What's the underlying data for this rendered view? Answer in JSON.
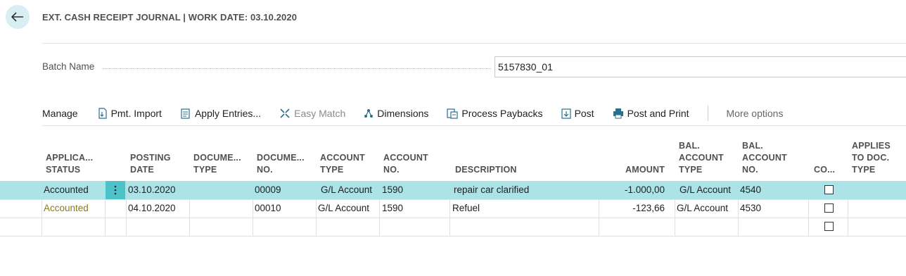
{
  "header": {
    "title": "EXT. CASH RECEIPT JOURNAL | WORK DATE: 03.10.2020"
  },
  "batch": {
    "label": "Batch Name",
    "value": "5157830_01"
  },
  "actions": {
    "manage": "Manage",
    "pmt_import": "Pmt. Import",
    "apply_entries": "Apply Entries...",
    "easy_match": "Easy Match",
    "dimensions": "Dimensions",
    "process_paybacks": "Process Paybacks",
    "post": "Post",
    "post_and_print": "Post and Print",
    "more_options": "More options"
  },
  "columns": {
    "applica_status": [
      "APPLICA...",
      "STATUS"
    ],
    "posting_date": [
      "POSTING",
      "DATE"
    ],
    "document_type": [
      "DOCUME...",
      "TYPE"
    ],
    "document_no": [
      "DOCUME...",
      "NO."
    ],
    "account_type": [
      "ACCOUNT",
      "TYPE"
    ],
    "account_no": [
      "ACCOUNT",
      "NO."
    ],
    "description": [
      "DESCRIPTION"
    ],
    "amount": [
      "AMOUNT"
    ],
    "bal_account_type": [
      "BAL.",
      "ACCOUNT",
      "TYPE"
    ],
    "bal_account_no": [
      "BAL.",
      "ACCOUNT",
      "NO."
    ],
    "co": [
      "CO..."
    ],
    "applies_to_doc_type": [
      "APPLIES",
      "TO DOC.",
      "TYPE"
    ]
  },
  "rows": [
    {
      "status": "Accounted",
      "posting_date": "03.10.2020",
      "doc_type": "",
      "doc_no": "00009",
      "account_type": "G/L Account",
      "account_no": "1590",
      "description": "repair car clarified",
      "amount": "-1.000,00",
      "bal_account_type": "G/L Account",
      "bal_account_no": "4540",
      "co": false,
      "applies_to_doc_type": ""
    },
    {
      "status": "Accounted",
      "posting_date": "04.10.2020",
      "doc_type": "",
      "doc_no": "00010",
      "account_type": "G/L Account",
      "account_no": "1590",
      "description": "Refuel",
      "amount": "-123,66",
      "bal_account_type": "G/L Account",
      "bal_account_no": "4530",
      "co": false,
      "applies_to_doc_type": ""
    },
    {
      "status": "",
      "posting_date": "",
      "doc_type": "",
      "doc_no": "",
      "account_type": "",
      "account_no": "",
      "description": "",
      "amount": "",
      "bal_account_type": "",
      "bal_account_no": "",
      "co": false,
      "applies_to_doc_type": ""
    }
  ],
  "colors": {
    "accent": "#4ec2c9",
    "selected_row": "#abe3e7",
    "status_accounted_alt": "#8a7a1a"
  }
}
